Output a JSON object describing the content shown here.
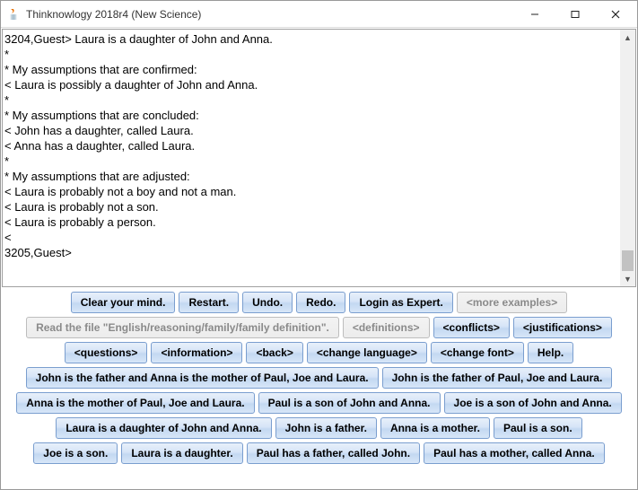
{
  "window": {
    "title": "Thinknowlogy 2018r4 (New Science)"
  },
  "console_text": "3204,Guest> Laura is a daughter of John and Anna.\n*\n* My assumptions that are confirmed:\n< Laura is possibly a daughter of John and Anna.\n*\n* My assumptions that are concluded:\n< John has a daughter, called Laura.\n< Anna has a daughter, called Laura.\n*\n* My assumptions that are adjusted:\n< Laura is probably not a boy and not a man.\n< Laura is probably not a son.\n< Laura is probably a person.\n<\n3205,Guest>",
  "toolbar": {
    "clear": "Clear your mind.",
    "restart": "Restart.",
    "undo": "Undo.",
    "redo": "Redo.",
    "login": "Login as Expert.",
    "more": "<more examples>"
  },
  "row2": {
    "readfile": "Read the file \"English/reasoning/family/family definition\".",
    "definitions": "<definitions>",
    "conflicts": "<conflicts>",
    "justifications": "<justifications>"
  },
  "row3": {
    "questions": "<questions>",
    "information": "<information>",
    "back": "<back>",
    "change_lang": "<change language>",
    "change_font": "<change font>",
    "help": "Help."
  },
  "examples": {
    "r4a": "John is the father and Anna is the mother of Paul, Joe and Laura.",
    "r4b": "John is the father of Paul, Joe and Laura.",
    "r5a": "Anna is the mother of Paul, Joe and Laura.",
    "r5b": "Paul is a son of John and Anna.",
    "r5c": "Joe is a son of John and Anna.",
    "r6a": "Laura is a daughter of John and Anna.",
    "r6b": "John is a father.",
    "r6c": "Anna is a mother.",
    "r6d": "Paul is a son.",
    "r7a": "Joe is a son.",
    "r7b": "Laura is a daughter.",
    "r7c": "Paul has a father, called John.",
    "r7d": "Paul has a mother, called Anna."
  }
}
